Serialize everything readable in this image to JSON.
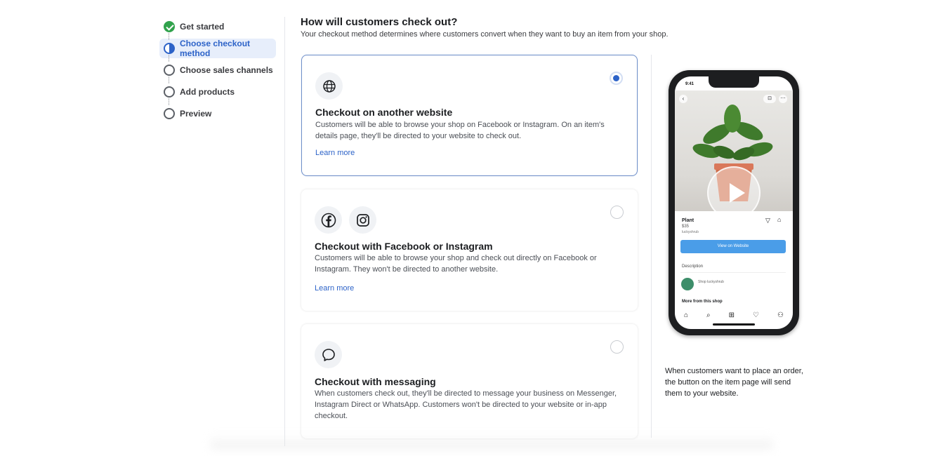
{
  "steps": [
    {
      "label": "Get started",
      "state": "done"
    },
    {
      "label": "Choose checkout method",
      "state": "active"
    },
    {
      "label": "Choose sales channels",
      "state": "todo"
    },
    {
      "label": "Add products",
      "state": "todo"
    },
    {
      "label": "Preview",
      "state": "todo"
    }
  ],
  "header": {
    "title": "How will customers check out?",
    "subtitle": "Your checkout method determines where customers convert when they want to buy an item from your shop."
  },
  "options": [
    {
      "title": "Checkout on another website",
      "desc": "Customers will be able to browse your shop on Facebook or Instagram. On an item's details page, they'll be directed to your website to check out.",
      "link": "Learn more",
      "selected": true,
      "icons": [
        "globe-icon"
      ]
    },
    {
      "title": "Checkout with Facebook or Instagram",
      "desc": "Customers will be able to browse your shop and check out directly on Facebook or Instagram. They won't be directed to another website.",
      "link": "Learn more",
      "selected": false,
      "icons": [
        "facebook-icon",
        "instagram-icon"
      ]
    },
    {
      "title": "Checkout with messaging",
      "desc": "When customers check out, they'll be directed to message your business on Messenger, Instagram Direct or WhatsApp. Customers won't be directed to your website or in-app checkout.",
      "selected": false,
      "icons": [
        "chat-bubble-icon"
      ]
    }
  ],
  "preview": {
    "time": "9:41",
    "product_name": "Plant",
    "price": "$35",
    "user": "luckyshrub",
    "button": "View on Website",
    "description_label": "Description",
    "shop": "Shop luckyshrub",
    "more": "More from this shop",
    "caption": "When customers want to place an order, the button on the item page will send them to your website."
  },
  "colors": {
    "accent": "#2d63c8",
    "success": "#31a24c",
    "link": "#2d63c8",
    "phone_button": "#4a9de8"
  }
}
